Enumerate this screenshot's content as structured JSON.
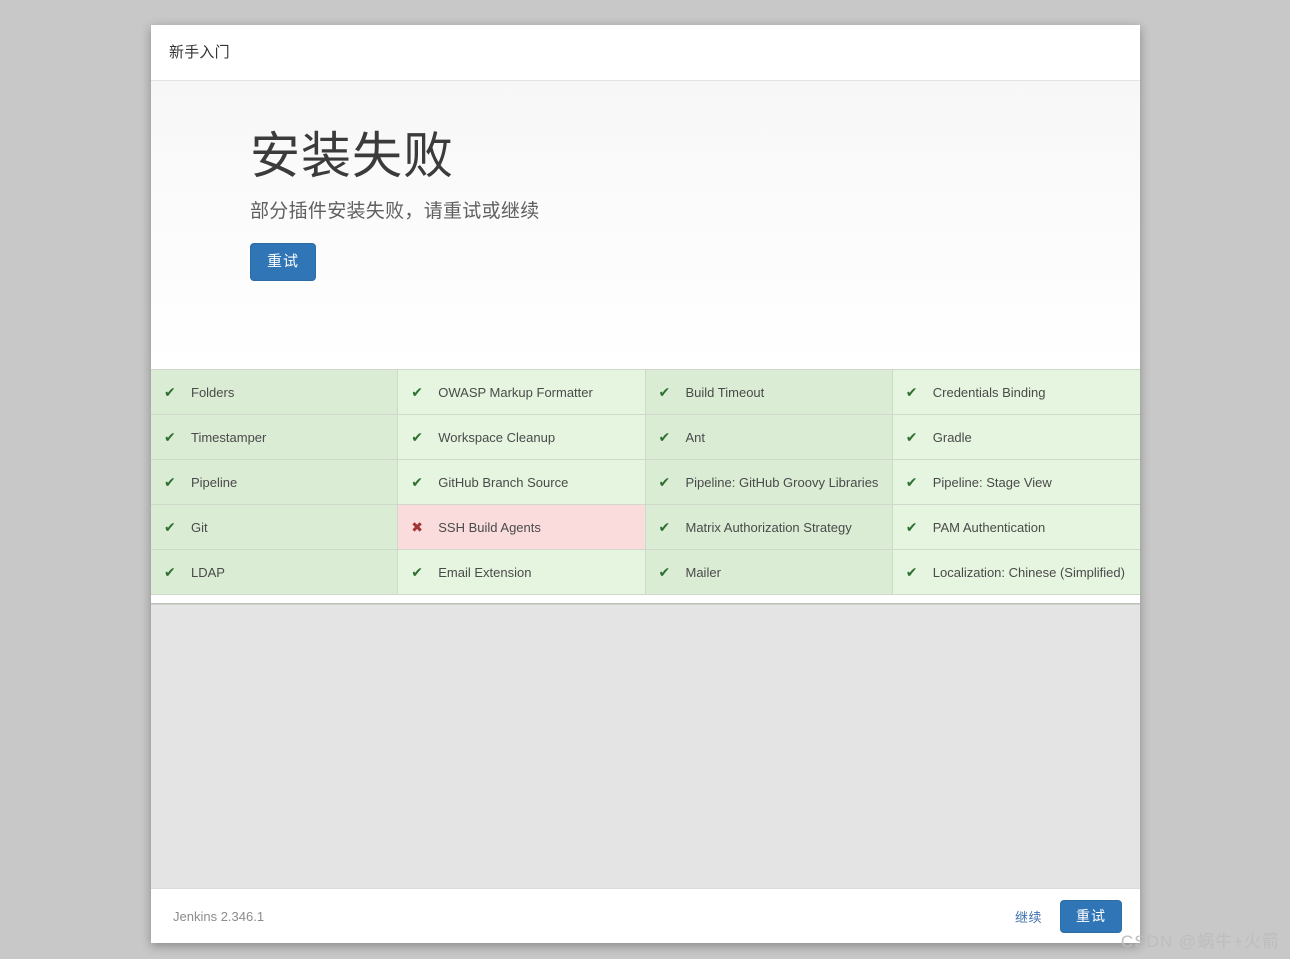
{
  "header": {
    "tab_label": "新手入门"
  },
  "hero": {
    "title": "安装失败",
    "subtitle": "部分插件安装失败，请重试或继续",
    "retry_label": "重试"
  },
  "colors": {
    "accent_blue": "#3075b5",
    "link_blue": "#3f72ad",
    "success_green": "#2d7030",
    "failure_red": "#a33434",
    "cell_green_dark": "#dbecd5",
    "cell_green_light": "#e6f5e0",
    "cell_red": "#fadcdc",
    "page_background": "#c8c8c8",
    "body_gray": "#e4e4e4"
  },
  "plugins": {
    "success_icon": "✔",
    "failure_icon": "✖",
    "items": [
      {
        "name": "Folders",
        "status": "success"
      },
      {
        "name": "OWASP Markup Formatter",
        "status": "success"
      },
      {
        "name": "Build Timeout",
        "status": "success"
      },
      {
        "name": "Credentials Binding",
        "status": "success"
      },
      {
        "name": "Timestamper",
        "status": "success"
      },
      {
        "name": "Workspace Cleanup",
        "status": "success"
      },
      {
        "name": "Ant",
        "status": "success"
      },
      {
        "name": "Gradle",
        "status": "success"
      },
      {
        "name": "Pipeline",
        "status": "success"
      },
      {
        "name": "GitHub Branch Source",
        "status": "success"
      },
      {
        "name": "Pipeline: GitHub Groovy Libraries",
        "status": "success"
      },
      {
        "name": "Pipeline: Stage View",
        "status": "success"
      },
      {
        "name": "Git",
        "status": "success"
      },
      {
        "name": "SSH Build Agents",
        "status": "failed"
      },
      {
        "name": "Matrix Authorization Strategy",
        "status": "success"
      },
      {
        "name": "PAM Authentication",
        "status": "success"
      },
      {
        "name": "LDAP",
        "status": "success"
      },
      {
        "name": "Email Extension",
        "status": "success"
      },
      {
        "name": "Mailer",
        "status": "success"
      },
      {
        "name": "Localization: Chinese (Simplified)",
        "status": "success"
      }
    ]
  },
  "footer": {
    "version": "Jenkins 2.346.1",
    "continue_label": "继续",
    "retry_label": "重试"
  },
  "watermark": {
    "text": "CSDN @蜗牛+火箭"
  }
}
